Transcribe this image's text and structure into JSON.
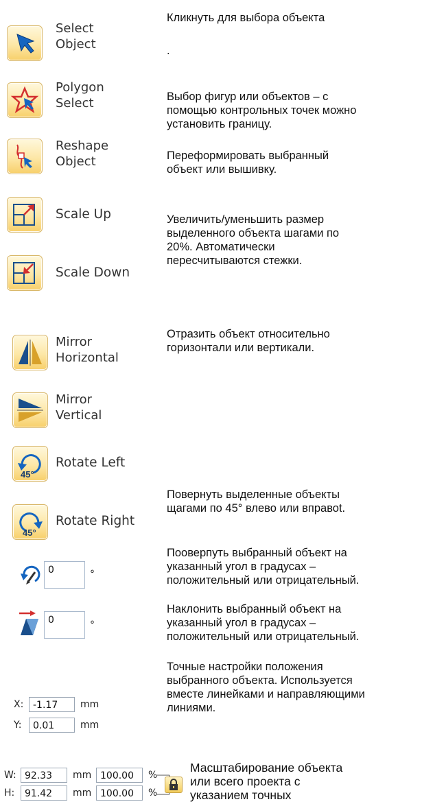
{
  "tools": {
    "select_object": {
      "label": "Select\nObject",
      "icon": "select-arrow-icon"
    },
    "polygon_select": {
      "label": "Polygon\nSelect",
      "icon": "polygon-select-icon"
    },
    "reshape_object": {
      "label": "Reshape\nObject",
      "icon": "reshape-icon"
    },
    "scale_up": {
      "label": "Scale Up",
      "icon": "scale-up-icon"
    },
    "scale_down": {
      "label": "Scale Down",
      "icon": "scale-down-icon"
    },
    "mirror_horizontal": {
      "label": "Mirror\nHorizontal",
      "icon": "mirror-horizontal-icon"
    },
    "mirror_vertical": {
      "label": "Mirror\nVertical",
      "icon": "mirror-vertical-icon"
    },
    "rotate_left": {
      "label": "Rotate Left",
      "icon": "rotate-left-45-icon",
      "badge": "45°"
    },
    "rotate_right": {
      "label": "Rotate Right",
      "icon": "rotate-right-45-icon",
      "badge": "45°"
    }
  },
  "controls": {
    "rotate_angle": {
      "value": "0",
      "unit": "°"
    },
    "skew_angle": {
      "value": "0",
      "unit": "°"
    },
    "position": {
      "x_label": "X:",
      "x_value": "-1.17",
      "y_label": "Y:",
      "y_value": "0.01",
      "unit": "mm"
    },
    "size": {
      "w_label": "W:",
      "w_value": "92.33",
      "h_label": "H:",
      "h_value": "91.42",
      "unit": "mm",
      "w_pct": "100.00",
      "h_pct": "100.00",
      "pct_unit": "%"
    }
  },
  "descriptions": {
    "select": "Кликнуть для выбора объекта",
    "select_dot": ".",
    "polygon": "Выбор фигур или объектов – с\nпомощью контрольных точек можно\nустановить границу.",
    "reshape": "Переформировать выбранный\nобъект или вышивку.",
    "scale": "Увеличить/уменьшить размер\nвыделенного объекта шагами по\n20%. Автоматически\nпересчитываются стежки.",
    "mirror": "Отразить объект относительно\nгоризонтали или вертикали.",
    "rotate45": "Повернуть выделенные объекты\nщагами по 45° влево или вправоt.",
    "rotate_angle": "Пооверпуть выбранный объект на\nуказанный угол в градусах –\nположительный или отрицательный.",
    "skew": "Наклонить выбранный объект на\nуказанный угол в градусах –\nположительный или отрицательный.",
    "position": "Точные настройки положения\nвыбранного объекта. Используется\nвместе линейками и направляющими\nлиниями.",
    "size": "Масштабирование объекта\nили всего проекта с\nуказанием точных"
  }
}
